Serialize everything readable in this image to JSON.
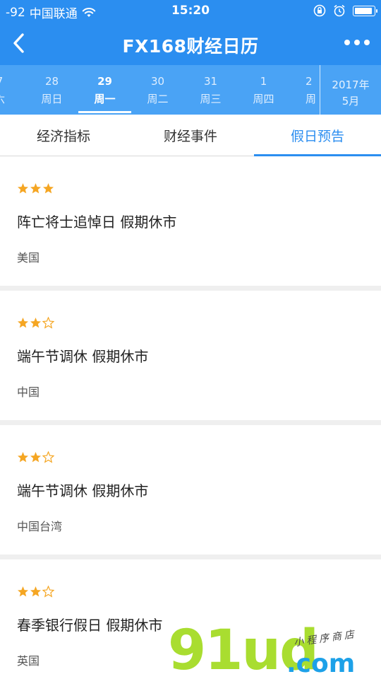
{
  "status_bar": {
    "signal": "-92",
    "carrier": "中国联通",
    "time": "15:20"
  },
  "nav": {
    "title": "FX168财经日历"
  },
  "dates": [
    {
      "num": "7",
      "week": "六",
      "active": false
    },
    {
      "num": "28",
      "week": "周日",
      "active": false
    },
    {
      "num": "29",
      "week": "周一",
      "active": true
    },
    {
      "num": "30",
      "week": "周二",
      "active": false
    },
    {
      "num": "31",
      "week": "周三",
      "active": false
    },
    {
      "num": "1",
      "week": "周四",
      "active": false
    },
    {
      "num": "2",
      "week": "周",
      "active": false
    }
  ],
  "month": {
    "year": "2017年",
    "month": "5月"
  },
  "tabs": [
    {
      "label": "经济指标",
      "active": false
    },
    {
      "label": "财经事件",
      "active": false
    },
    {
      "label": "假日预告",
      "active": true
    }
  ],
  "colors": {
    "primary": "#2b8ef0",
    "star": "#f5a623"
  },
  "items": [
    {
      "stars": 3,
      "title": "阵亡将士追悼日 假期休市",
      "country": "美国"
    },
    {
      "stars": 2,
      "title": "端午节调休 假期休市",
      "country": "中国"
    },
    {
      "stars": 2,
      "title": "端午节调休 假期休市",
      "country": "中国台湾"
    },
    {
      "stars": 2,
      "title": "春季银行假日 假期休市",
      "country": "英国"
    }
  ],
  "watermark": {
    "main": "91ud",
    "domain": ".com",
    "tagline": "小程序商店"
  }
}
